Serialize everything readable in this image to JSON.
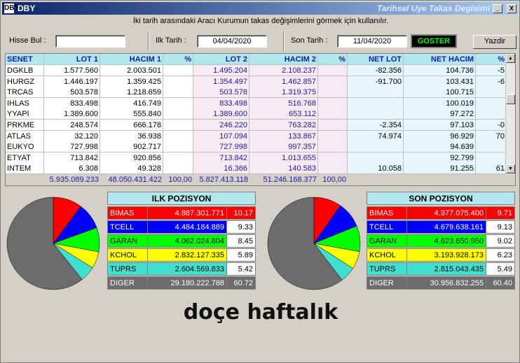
{
  "window": {
    "icon": "DBY",
    "title": "DBY",
    "subtitle": "Tarihsel Uye Takas Degisimi",
    "min_label": "_",
    "max_label": "□",
    "close_label": "X"
  },
  "description": "İki tarih arasındaki  Aracı Kurumun takas değişimlerini görmek için kullanılır.",
  "controls": {
    "hisse_label": "Hisse Bul :",
    "hisse_value": "",
    "ilk_label": "Ilk Tarih :",
    "ilk_value": "04/04/2020",
    "son_label": "Son Tarih :",
    "son_value": "11/04/2020",
    "goster_label": "GOSTER",
    "yazdir_label": "Yazdir"
  },
  "table": {
    "headers": [
      "SENET",
      "LOT 1",
      "HACIM 1",
      "%",
      "LOT 2",
      "HACIM 2",
      "%",
      "NET LOT",
      "NET HACIM",
      "%"
    ],
    "rows": [
      [
        "DGKLB",
        "1.577.560",
        "2.003.501",
        "",
        "1.495.204",
        "2.108.237",
        "",
        "-82.356",
        "104.736",
        "-5"
      ],
      [
        "HURGZ",
        "1.446.197",
        "1.359.425",
        "",
        "1.354.497",
        "1.462.857",
        "",
        "-91.700",
        "103.431",
        "-6"
      ],
      [
        "TRCAS",
        "503.578",
        "1.218.659",
        "",
        "503.578",
        "1.319.375",
        "",
        "",
        "100.715",
        ""
      ],
      [
        "IHLAS",
        "833.498",
        "416.749",
        "",
        "833.498",
        "516.768",
        "",
        "",
        "100.019",
        ""
      ],
      [
        "YYAPI",
        "1.389.600",
        "555.840",
        "",
        "1.389.600",
        "653.112",
        "",
        "",
        "97.272",
        ""
      ],
      [
        "PRKME",
        "248.574",
        "666.178",
        "",
        "246.220",
        "763.282",
        "",
        "-2.354",
        "97.103",
        "-0"
      ],
      [
        "ATLAS",
        "32.120",
        "36.938",
        "",
        "107.094",
        "133.867",
        "",
        "74.974",
        "96.929",
        "70"
      ],
      [
        "EUKYO",
        "727.998",
        "902.717",
        "",
        "727.998",
        "997.357",
        "",
        "",
        "94.639",
        ""
      ],
      [
        "ETYAT",
        "713.842",
        "920.856",
        "",
        "713.842",
        "1.013.655",
        "",
        "",
        "92.799",
        ""
      ],
      [
        "INTEM",
        "6.308",
        "49.328",
        "",
        "16.366",
        "140.583",
        "",
        "10.058",
        "91.255",
        "61"
      ]
    ],
    "totals": [
      "5.935.089.233",
      "48.050.431.422",
      "100,00",
      "5.827.413.118",
      "51.246.168.377",
      "100,00"
    ]
  },
  "ilk_pozisyon": {
    "title": "ILK POZISYON",
    "rows": [
      {
        "name": "BIMAS",
        "value": "4.887.301.771",
        "pct": "10.17",
        "color": "#ff0000",
        "text": "#ffffff",
        "pctbg": "#ff0000"
      },
      {
        "name": "TCELL",
        "value": "4.484.184.889",
        "pct": "9.33",
        "color": "#0000ff",
        "text": "#ffffff",
        "pctbg": "#ffffff"
      },
      {
        "name": "GARAN",
        "value": "4.062.024.804",
        "pct": "8.45",
        "color": "#00ff00",
        "text": "#000000",
        "pctbg": "#ffffff"
      },
      {
        "name": "KCHOL",
        "value": "2.832.127.335",
        "pct": "5.89",
        "color": "#ffff00",
        "text": "#000000",
        "pctbg": "#ffffff"
      },
      {
        "name": "TUPRS",
        "value": "2.604.569.833",
        "pct": "5.42",
        "color": "#40e0d0",
        "text": "#000000",
        "pctbg": "#ffffff"
      },
      {
        "name": "DIGER",
        "value": "29.180.222.788",
        "pct": "60.72",
        "color": "#6c6c6c",
        "text": "#ffffff",
        "pctbg": "#6c6c6c"
      }
    ]
  },
  "son_pozisyon": {
    "title": "SON POZISYON",
    "rows": [
      {
        "name": "BIMAS",
        "value": "4.977.075.400",
        "pct": "9.71",
        "color": "#ff0000",
        "text": "#ffffff",
        "pctbg": "#ff0000"
      },
      {
        "name": "TCELL",
        "value": "4.679.638.161",
        "pct": "9.13",
        "color": "#0000ff",
        "text": "#ffffff",
        "pctbg": "#ffffff"
      },
      {
        "name": "GARAN",
        "value": "4.623.650.950",
        "pct": "9.02",
        "color": "#00ff00",
        "text": "#000000",
        "pctbg": "#ffffff"
      },
      {
        "name": "KCHOL",
        "value": "3.193.928.173",
        "pct": "6.23",
        "color": "#ffff00",
        "text": "#000000",
        "pctbg": "#ffffff"
      },
      {
        "name": "TUPRS",
        "value": "2.815.043.435",
        "pct": "5.49",
        "color": "#40e0d0",
        "text": "#000000",
        "pctbg": "#ffffff"
      },
      {
        "name": "DIGER",
        "value": "30.956.832.255",
        "pct": "60.40",
        "color": "#6c6c6c",
        "text": "#ffffff",
        "pctbg": "#6c6c6c"
      }
    ]
  },
  "caption": "doçe haftalık"
}
